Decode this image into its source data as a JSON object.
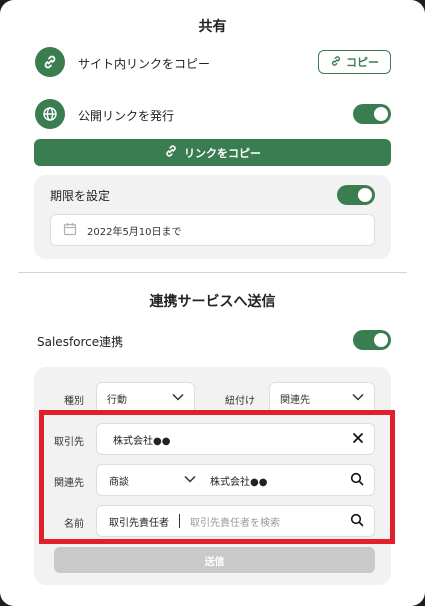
{
  "share": {
    "title": "共有",
    "site_link_label": "サイト内リンクをコピー",
    "copy_button": "コピー",
    "public_link_label": "公開リンクを発行",
    "public_link_enabled": true,
    "copy_link_button": "リンクをコピー",
    "expiry_label": "期限を設定",
    "expiry_enabled": true,
    "expiry_date": "2022年5月10日まで"
  },
  "integration": {
    "title": "連携サービスへ送信",
    "salesforce_label": "Salesforce連携",
    "salesforce_enabled": true,
    "type_label": "種別",
    "type_value": "行動",
    "link_label": "紐付け",
    "link_value": "関連先",
    "account_label": "取引先",
    "account_value": "株式会社●●",
    "related_label": "関連先",
    "related_type": "商談",
    "related_value": "株式会社●●",
    "name_label": "名前",
    "name_prefix": "取引先責任者",
    "name_placeholder": "取引先責任者を検索",
    "submit_button": "送信"
  },
  "colors": {
    "accent": "#3a7d51",
    "highlight_frame": "#e0202a",
    "disabled": "#c9c9c9"
  }
}
